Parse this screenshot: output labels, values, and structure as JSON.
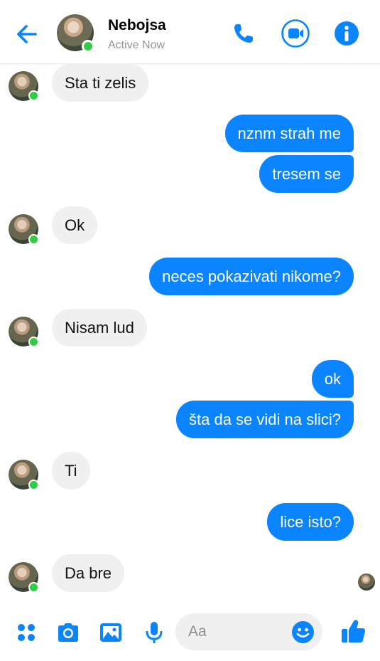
{
  "header": {
    "contact_name": "Nebojsa",
    "status": "Active Now",
    "icons": [
      "back-arrow-icon",
      "phone-icon",
      "video-camera-icon",
      "info-icon"
    ]
  },
  "theme": {
    "accent": "#0a84ff",
    "incoming_bubble": "#f1f0f0",
    "online": "#31cc46"
  },
  "messages": [
    {
      "direction": "in",
      "text": "Sta ti zelis"
    },
    {
      "direction": "out",
      "text": "nznm strah me"
    },
    {
      "direction": "out",
      "text": "tresem se"
    },
    {
      "direction": "in",
      "text": "Ok"
    },
    {
      "direction": "out",
      "text": "neces pokazivati nikome?"
    },
    {
      "direction": "in",
      "text": "Nisam lud"
    },
    {
      "direction": "out",
      "text": "ok"
    },
    {
      "direction": "out",
      "text": "šta da se vidi na slici?"
    },
    {
      "direction": "in",
      "text": "Ti"
    },
    {
      "direction": "out",
      "text": "lice isto?"
    },
    {
      "direction": "in",
      "text": "Da bre"
    }
  ],
  "composer": {
    "placeholder": "Aa",
    "icons": [
      "apps-grid-icon",
      "camera-icon",
      "gallery-icon",
      "microphone-icon",
      "emoji-icon",
      "thumbs-up-icon"
    ]
  }
}
